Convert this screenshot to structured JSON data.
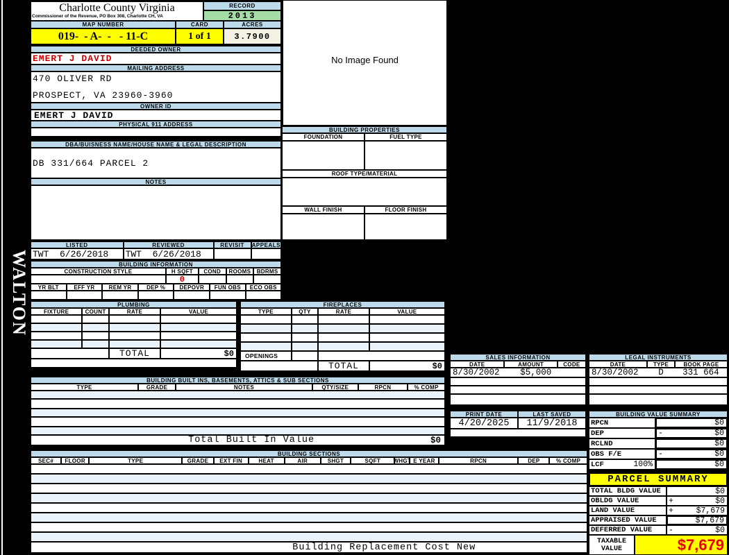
{
  "palette": {
    "header_blue": "#BCDAEA",
    "row_pale_blue": "#EAF3F9",
    "record_green": "#A6DDA6",
    "highlight_yellow": "#FFFF00",
    "acres_cream": "#F2F1E4",
    "owner_red": "#CC0000",
    "taxable_red": "#E80000"
  },
  "watermark": "WALTON",
  "header": {
    "county": "Charlotte County Virginia",
    "commissioner_line": "Commissioner of the Revenue, PO Box 308, Charlotte CH, VA",
    "record_label": "RECORD",
    "record_year": "2013",
    "map_number_label": "MAP NUMBER",
    "map_number": "019-  - A-  -   - 11-C",
    "card_label": "CARD",
    "card": "1 of 1",
    "acres_label": "ACRES",
    "acres": "3.7900"
  },
  "owner": {
    "deeded_owner_label": "DEEDED OWNER",
    "deeded_owner": "EMERT J DAVID",
    "mailing_address_label": "MAILING ADDRESS",
    "address_line1": "470 OLIVER RD",
    "address_line2": "PROSPECT, VA 23960-3960",
    "owner_id_label": "OWNER ID",
    "owner_id": "EMERT J DAVID",
    "physical_911_label": "PHYSICAL 911 ADDRESS",
    "dba_label": "DBA/BUISNESS NAME/HOUSE NAME & LEGAL DESCRIPTION",
    "legal_description": "DB 331/664 PARCEL 2",
    "notes_label": "NOTES"
  },
  "review": {
    "headers": [
      "LISTED",
      "REVIEWED",
      "REVISIT",
      "APPEALS"
    ],
    "listed": "TWT  6/26/2018",
    "reviewed": "TWT  6/26/2018",
    "revisit": "",
    "appeals": ""
  },
  "building_info": {
    "title": "BUILDING INFORMATION",
    "row1_headers": [
      "CONSTRUCTION STYLE",
      "H SQFT",
      "COND",
      "ROOMS",
      "BDRMS"
    ],
    "h_sqft": "0",
    "row2_headers": [
      "YR BLT",
      "EFF YR",
      "REM YR",
      "DEP %",
      "DEPOVR",
      "FUN OBS",
      "ECO OBS"
    ]
  },
  "plumbing": {
    "title": "PLUMBING",
    "headers": [
      "FIXTURE",
      "COUNT",
      "RATE",
      "VALUE"
    ],
    "total_label": "TOTAL",
    "total": "$0"
  },
  "fireplaces": {
    "title": "FIREPLACES",
    "headers": [
      "TYPE",
      "QTY",
      "RATE",
      "VALUE"
    ],
    "openings_label": "OPENINGS",
    "total_label": "TOTAL",
    "total": "$0"
  },
  "built_ins": {
    "title": "BUILDING BUILT INS, BASEMENTS, ATTICS & SUB SECTIONS",
    "headers": [
      "TYPE",
      "GRADE",
      "NOTES",
      "QTY/SIZE",
      "RPCN",
      "% COMP"
    ],
    "total_label": "Total Built In Value",
    "total": "$0"
  },
  "building_sections": {
    "title": "BUILDING SECTIONS",
    "headers": [
      "SEC#",
      "FLOOR",
      "TYPE",
      "GRADE",
      "EXT FIN",
      "HEAT",
      "AIR",
      "SHGT",
      "SQFT",
      "WHGT",
      "E YEAR",
      "RPCN",
      "DEP",
      "% COMP"
    ],
    "footer": "Building Replacement Cost New"
  },
  "image_box": {
    "text": "No Image Found"
  },
  "building_properties": {
    "title": "BUILDING PROPERTIES",
    "foundation_label": "FOUNDATION",
    "fuel_label": "FUEL TYPE",
    "roof_label": "ROOF TYPE/MATERIAL",
    "wall_label": "WALL FINISH",
    "floor_label": "FLOOR FINISH"
  },
  "sales": {
    "title": "SALES INFORMATION",
    "headers": [
      "DATE",
      "AMOUNT",
      "CODE"
    ],
    "rows": [
      [
        "8/30/2002",
        "$5,000",
        ""
      ]
    ]
  },
  "legal": {
    "title": "LEGAL INSTRUMENTS",
    "headers": [
      "DATE",
      "TYPE",
      "BOOK PAGE"
    ],
    "rows": [
      [
        "8/30/2002",
        "D",
        "331 664"
      ]
    ]
  },
  "print_info": {
    "print_date_label": "PRINT DATE",
    "print_date": "4/20/2025",
    "last_saved_label": "LAST SAVED",
    "last_saved": "11/9/2018"
  },
  "value_summary": {
    "title": "BUILDING VALUE SUMMARY",
    "rows": [
      {
        "label": "RPCN",
        "pct": "",
        "sign": "",
        "value": "$0"
      },
      {
        "label": "DEP",
        "pct": "",
        "sign": "-",
        "value": "$0"
      },
      {
        "label": "RCLND",
        "pct": "",
        "sign": "",
        "value": "$0"
      },
      {
        "label": "OBS F/E",
        "pct": "",
        "sign": "-",
        "value": "$0"
      },
      {
        "label": "LCF",
        "pct": "100%",
        "sign": "",
        "value": "$0"
      }
    ]
  },
  "parcel_summary": {
    "title": "PARCEL SUMMARY",
    "rows": [
      {
        "label": "TOTAL BLDG VALUE",
        "sign": "",
        "value": "$0"
      },
      {
        "label": "OBLDG VALUE",
        "sign": "+",
        "value": "$0"
      },
      {
        "label": "LAND VALUE",
        "sign": "+",
        "value": "$7,679"
      },
      {
        "label": "APPRAISED VALUE",
        "sign": "",
        "value": "$7,679"
      },
      {
        "label": "DEFERRED VALUE",
        "sign": "-",
        "value": "$0"
      }
    ],
    "taxable_label_1": "TAXABLE",
    "taxable_label_2": "VALUE",
    "taxable_value": "$7,679"
  }
}
